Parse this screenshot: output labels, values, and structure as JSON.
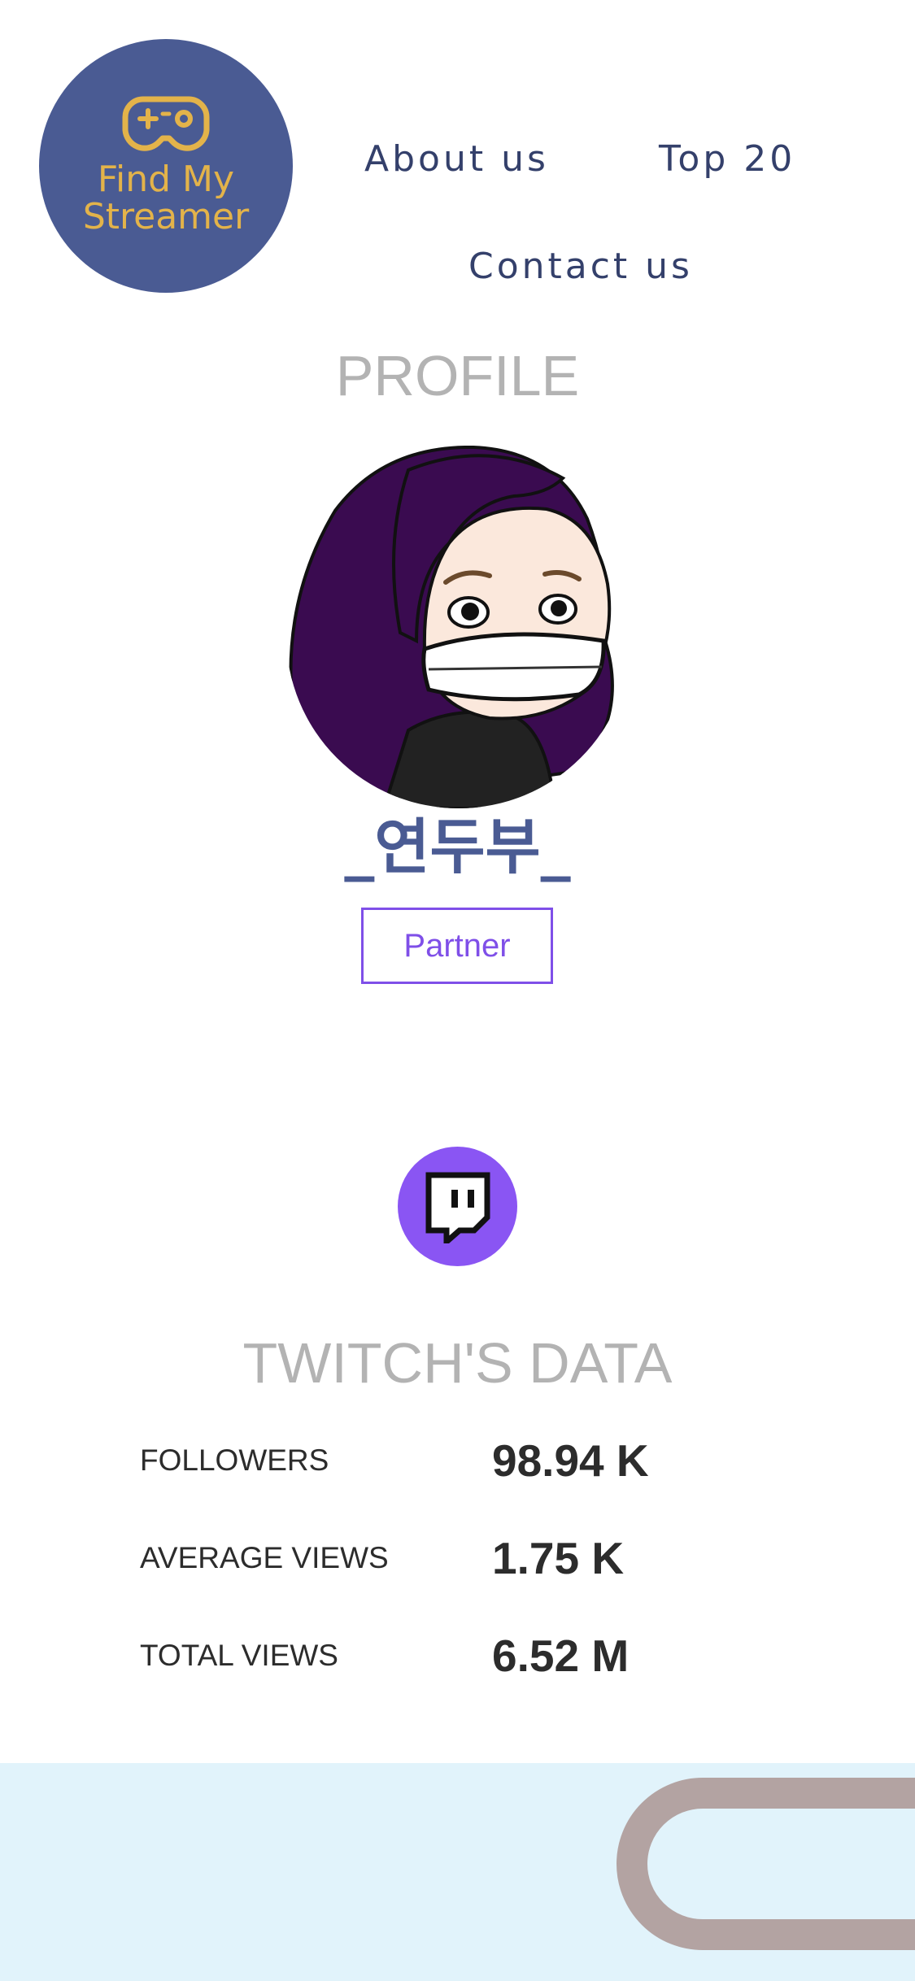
{
  "brand": {
    "logo_line1": "Find My",
    "logo_line2": "Streamer",
    "logo_icon": "gamepad-icon"
  },
  "nav": {
    "about": "About us",
    "top20": "Top 20",
    "contact": "Contact us"
  },
  "profile": {
    "section_title": "PROFILE",
    "streamer_name": "_연두부_",
    "badge": "Partner"
  },
  "twitch": {
    "icon": "twitch-icon",
    "section_title": "TWITCH'S DATA",
    "stats": [
      {
        "label": "FOLLOWERS",
        "value": "98.94 K"
      },
      {
        "label": "AVERAGE VIEWS",
        "value": "1.75 K"
      },
      {
        "label": "TOTAL VIEWS",
        "value": "6.52 M"
      }
    ]
  },
  "colors": {
    "brand_blue": "#4a5b93",
    "brand_gold": "#e3b34a",
    "twitch_purple": "#8a55f3",
    "footer_bg": "#e1f3fb"
  }
}
